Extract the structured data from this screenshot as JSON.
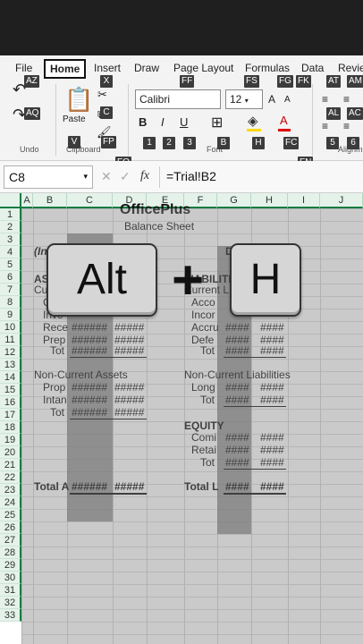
{
  "ribbon": {
    "tabs": [
      "File",
      "Home",
      "Insert",
      "Draw",
      "Page Layout",
      "Formulas",
      "Data",
      "Review"
    ],
    "groups": {
      "undo": "Undo",
      "clipboard": "Clipboard",
      "font": "Font",
      "alignment": "Alignm"
    },
    "paste_label": "Paste",
    "font_name": "Calibri",
    "font_size": "12",
    "keytips": {
      "az": "AZ",
      "aq": "AQ",
      "x": "X",
      "c": "C",
      "v": "V",
      "fp": "FP",
      "fo": "FO",
      "ff": "FF",
      "fs": "FS",
      "fg": "FG",
      "fk": "FK",
      "at": "AT",
      "am": "AM",
      "one": "1",
      "two": "2",
      "three": "3",
      "b": "B",
      "h": "H",
      "fc": "FC",
      "fn": "FN",
      "al": "AL",
      "ac": "AC",
      "five": "5",
      "six": "6"
    }
  },
  "formula_bar": {
    "cell_ref": "C8",
    "fx": "fx",
    "formula": "=Trial!B2"
  },
  "sheet": {
    "columns": [
      "A",
      "B",
      "C",
      "D",
      "E",
      "F",
      "G",
      "H",
      "I",
      "J"
    ],
    "rows": [
      "1",
      "2",
      "3",
      "4",
      "5",
      "6",
      "7",
      "8",
      "9",
      "10",
      "11",
      "12",
      "13",
      "14",
      "15",
      "16",
      "17",
      "18",
      "19",
      "20",
      "21",
      "22",
      "23",
      "24",
      "25",
      "26",
      "27",
      "28",
      "29",
      "30",
      "31",
      "32",
      "33"
    ],
    "cells": {
      "title": "OfficePlus",
      "subtitle": "Balance Sheet",
      "r4b": "(In",
      "r4f": "D",
      "r6b": "ASS",
      "r6f": "LIABILITI",
      "r7b": "Cu",
      "r7f": "Current L",
      "r8b": "C",
      "r8f": "Acco",
      "r9b": "Inve",
      "r9f": "Incor",
      "r10b": "Rece",
      "r10f": "Accru",
      "r11b": "Prep",
      "r11f": "Defe",
      "r12b": "Tot",
      "r12f": "Tot",
      "r14b": "Non-Current Assets",
      "r14f": "Non-Current Liabilities",
      "r15b": "Prop",
      "r15f": "Long",
      "r16b": "Intan",
      "r16f": "Tot",
      "r17b": "Tot",
      "r19f": "EQUITY",
      "r20f": "Comi",
      "r21f": "Retai",
      "r22f": "Tot",
      "r23b": "Total A",
      "r23f": "Total L",
      "hash6": "######",
      "hash5": "#####",
      "hash4": "####"
    }
  },
  "keys": {
    "first": "Alt",
    "plus": "+",
    "second": "H"
  }
}
